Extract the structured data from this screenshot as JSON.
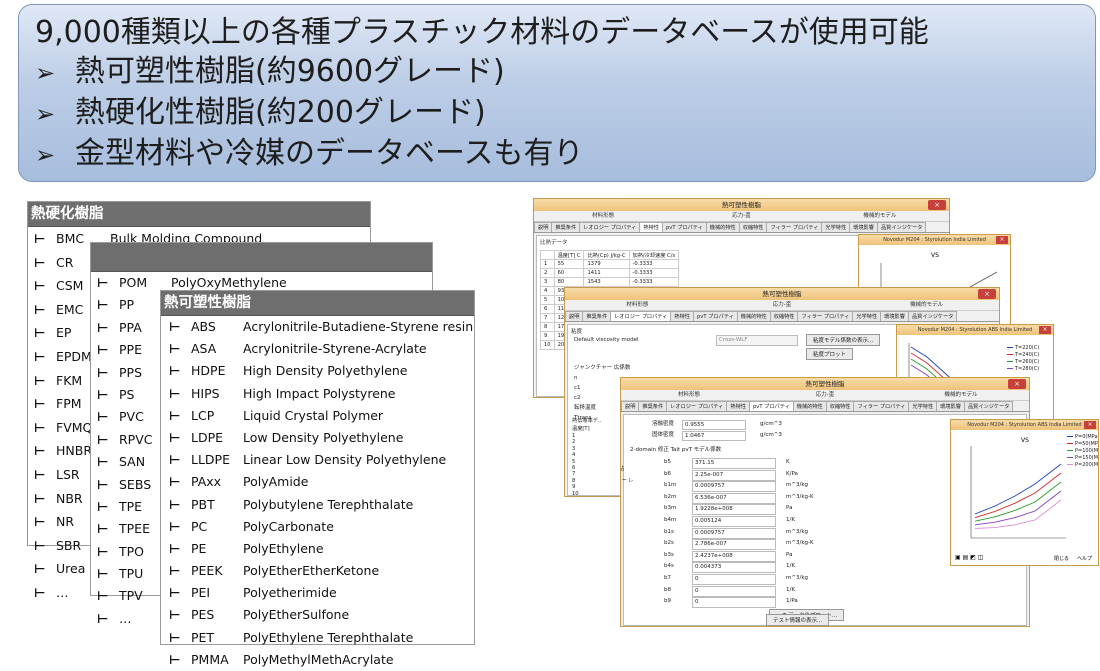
{
  "banner": {
    "line1": "9,000種類以上の各種プラスチック材料のデータベースが使用可能",
    "bullet_icon": "➢",
    "items": [
      "熱可塑性樹脂(約9600グレード)",
      "熱硬化性樹脂(約200グレード)",
      "金型材料や冷媒のデータベースも有り"
    ]
  },
  "thermoset_panel": {
    "title": "熱硬化樹脂",
    "tick": "⊢",
    "rows": [
      {
        "code": "BMC",
        "name": "Bulk Molding Compound"
      },
      {
        "code": "CR",
        "name": ""
      },
      {
        "code": "CSM",
        "name": ""
      },
      {
        "code": "EMC",
        "name": ""
      },
      {
        "code": "EP",
        "name": ""
      },
      {
        "code": "EPDM",
        "name": ""
      },
      {
        "code": "FKM",
        "name": ""
      },
      {
        "code": "FPM",
        "name": ""
      },
      {
        "code": "FVMQ",
        "name": ""
      },
      {
        "code": "HNBR",
        "name": ""
      },
      {
        "code": "LSR",
        "name": ""
      },
      {
        "code": "NBR",
        "name": ""
      },
      {
        "code": "NR",
        "name": ""
      },
      {
        "code": "SBR",
        "name": ""
      },
      {
        "code": "Urea",
        "name": ""
      },
      {
        "code": "…",
        "name": ""
      }
    ]
  },
  "middle_panel": {
    "title": "",
    "rows": [
      {
        "code": "POM",
        "name": "PolyOxyMethylene"
      },
      {
        "code": "PP",
        "name": ""
      },
      {
        "code": "PPA",
        "name": ""
      },
      {
        "code": "PPE",
        "name": ""
      },
      {
        "code": "PPS",
        "name": ""
      },
      {
        "code": "PS",
        "name": ""
      },
      {
        "code": "PVC",
        "name": ""
      },
      {
        "code": "RPVC",
        "name": ""
      },
      {
        "code": "SAN",
        "name": ""
      },
      {
        "code": "SEBS",
        "name": ""
      },
      {
        "code": "TPE",
        "name": ""
      },
      {
        "code": "TPEE",
        "name": ""
      },
      {
        "code": "TPO",
        "name": ""
      },
      {
        "code": "TPU",
        "name": ""
      },
      {
        "code": "TPV",
        "name": ""
      },
      {
        "code": "…",
        "name": ""
      }
    ]
  },
  "thermoplastic_panel": {
    "title": "熱可塑性樹脂",
    "rows": [
      {
        "code": "ABS",
        "name": "Acrylonitrile-Butadiene-Styrene resin"
      },
      {
        "code": "ASA",
        "name": "Acrylonitrile-Styrene-Acrylate"
      },
      {
        "code": "HDPE",
        "name": "High Density Polyethylene"
      },
      {
        "code": "HIPS",
        "name": "High Impact Polystyrene"
      },
      {
        "code": "LCP",
        "name": "Liquid Crystal Polymer"
      },
      {
        "code": "LDPE",
        "name": "Low Density Polyethylene"
      },
      {
        "code": "LLDPE",
        "name": "Linear Low Density Polyethylene"
      },
      {
        "code": "PAxx",
        "name": "PolyAmide"
      },
      {
        "code": "PBT",
        "name": "Polybutylene Terephthalate"
      },
      {
        "code": "PC",
        "name": "PolyCarbonate"
      },
      {
        "code": "PE",
        "name": "PolyEthylene"
      },
      {
        "code": "PEEK",
        "name": "PolyEtherEtherKetone"
      },
      {
        "code": "PEI",
        "name": "Polyetherimide"
      },
      {
        "code": "PES",
        "name": "PolyEtherSulfone"
      },
      {
        "code": "PET",
        "name": "PolyEthylene Terephthalate"
      },
      {
        "code": "PMMA",
        "name": "PolyMethylMethAcrylate"
      }
    ]
  },
  "app_windows": {
    "window_title": "熱可塑性樹脂",
    "close_label": "×",
    "group_headers": [
      "材料形態",
      "応力-歪",
      "機械的モデル"
    ],
    "tabs": [
      "説明",
      "推奨条件",
      "レオロジー プロパティ",
      "熱特性",
      "pvT プロパティ",
      "機械的特性",
      "収縮特性",
      "フィラー プロパティ",
      "光学特性",
      "環境影響",
      "品質インジケータ"
    ],
    "back": {
      "section": "比熱データ",
      "table_header": [
        "温度[T] C",
        "比熱(Cp) J/kg-C",
        "加熱/冷却速度 C/s"
      ],
      "rows": [
        [
          "1",
          "55",
          "1379",
          "-0.3333"
        ],
        [
          "2",
          "60",
          "1411",
          "-0.3333"
        ],
        [
          "3",
          "80",
          "1543",
          "-0.3333"
        ],
        [
          "4",
          "93",
          "1673",
          "-0.3333"
        ],
        [
          "5",
          "10",
          "",
          ""
        ],
        [
          "6",
          "11",
          "",
          ""
        ],
        [
          "7",
          "12",
          "",
          ""
        ],
        [
          "8",
          "17",
          "",
          ""
        ],
        [
          "9",
          "19",
          "",
          ""
        ],
        [
          "10",
          "20",
          "",
          ""
        ]
      ]
    },
    "middle": {
      "section": "粘度",
      "model_label": "Default viscosity model",
      "model_value": "Cross-WLF",
      "btn_show": "粘度モデル係数の表示...",
      "btn_plot": "粘度プロット",
      "juncture": "ジャンクチャー 広係数",
      "rows": [
        "n",
        "c1",
        "c2",
        "転移温度",
        "Ttrans"
      ],
      "side_rows": [
        "1",
        "2",
        "3",
        "4",
        "5",
        "6",
        "7",
        "8",
        "9",
        "10"
      ],
      "side_labels": [
        "熱伝導率デ..",
        "温度[T]"
      ]
    },
    "front": {
      "rows_top": [
        {
          "k": "溶融密度",
          "v": "0.9555",
          "u": "g/cm^3"
        },
        {
          "k": "固体密度",
          "v": "1.0467",
          "u": "g/cm^3"
        }
      ],
      "section": "2-domain 修正 Tait pvT モデル係数",
      "left_labels": [
        "Moldflow 粘",
        "メルト フロー レ",
        "温度",
        "荷重",
        "測定 MFR",
        "評価比較"
      ],
      "params": [
        {
          "k": "b5",
          "v": "371.15",
          "u": "K"
        },
        {
          "k": "b6",
          "v": "2.25e-007",
          "u": "K/Pa"
        },
        {
          "k": "b1m",
          "v": "0.0009757",
          "u": "m^3/kg"
        },
        {
          "k": "b2m",
          "v": "6.536e-007",
          "u": "m^3/kg-K"
        },
        {
          "k": "b3m",
          "v": "1.9228e+008",
          "u": "Pa"
        },
        {
          "k": "b4m",
          "v": "0.005124",
          "u": "1/K"
        },
        {
          "k": "b1s",
          "v": "0.0009757",
          "u": "m^3/kg"
        },
        {
          "k": "b2s",
          "v": "2.786e-007",
          "u": "m^3/kg-K"
        },
        {
          "k": "b3s",
          "v": "2.4237e+008",
          "u": "Pa"
        },
        {
          "k": "b4s",
          "v": "0.004373",
          "u": "1/K"
        },
        {
          "k": "b7",
          "v": "0",
          "u": "m^3/kg"
        },
        {
          "k": "b8",
          "v": "0",
          "u": "1/K"
        },
        {
          "k": "b9",
          "v": "0",
          "u": "1/Pa"
        }
      ],
      "btn_pvt": "pvT データのプロット...",
      "btn_test": "テスト情報の表示..."
    },
    "charts": [
      {
        "title": "Novodur M204 : Styrolution India Limited",
        "label": "VS"
      },
      {
        "title": "Novodur M204 : Styrolution ABS India Limited",
        "legend": [
          "T=220(C)",
          "T=240(C)",
          "T=260(C)",
          "T=280(C)"
        ]
      },
      {
        "title": "Novodur M204 : Styrolution ABS India Limited",
        "label": "VS",
        "legend": [
          "P=0(MPa)",
          "P=50(MPa)",
          "P=100(MPa)",
          "P=150(MPa)",
          "P=200(MPa)"
        ],
        "buttons": [
          "閉じる",
          "ヘルプ"
        ]
      }
    ],
    "colors": {
      "series": [
        "#1f3fbf",
        "#d12a2a",
        "#2a9a2a",
        "#8a3bbf",
        "#e08ad9"
      ]
    }
  }
}
